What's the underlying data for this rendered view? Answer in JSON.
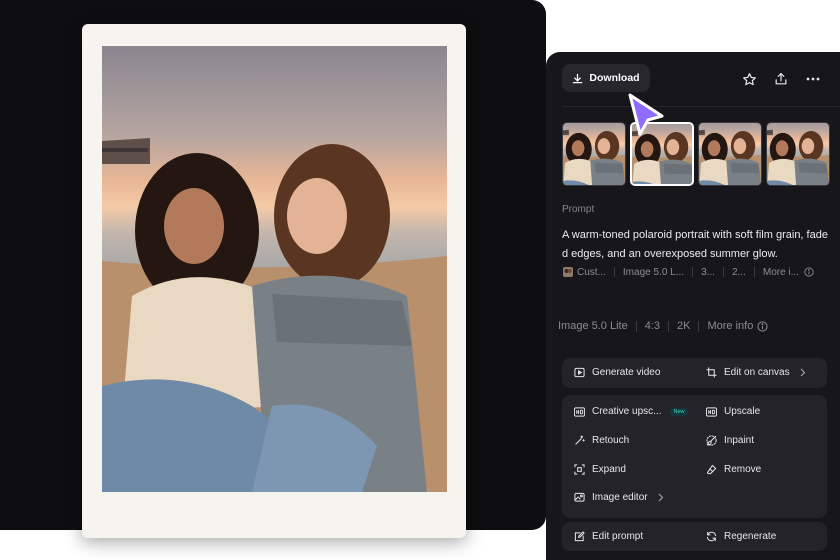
{
  "toolbar": {
    "download_label": "Download",
    "icons": [
      "download-icon",
      "star-icon",
      "share-icon",
      "more-icon"
    ]
  },
  "thumbnails": {
    "count": 4,
    "selected_index": 1
  },
  "prompt": {
    "label": "Prompt",
    "text": "A warm-toned polaroid portrait with soft film grain, faded edges, and an overexposed summer glow."
  },
  "meta_chips": [
    "Cust...",
    "Image 5.0 L...",
    "3...",
    "2...",
    "More i..."
  ],
  "specs": {
    "model": "Image 5.0 Lite",
    "ratio": "4:3",
    "resolution": "2K",
    "more_info": "More info"
  },
  "actions": {
    "generate_video": "Generate video",
    "edit_on_canvas": "Edit on canvas",
    "creative_upscale": "Creative upsc...",
    "new_badge": "New",
    "upscale": "Upscale",
    "retouch": "Retouch",
    "inpaint": "Inpaint",
    "expand": "Expand",
    "remove": "Remove",
    "image_editor": "Image editor",
    "edit_prompt": "Edit prompt",
    "regenerate": "Regenerate"
  },
  "colors": {
    "stage_bg": "#0e0e11",
    "panel_bg": "#17171b",
    "card_bg": "#232329",
    "cursor_accent": "#8f6bff",
    "new_badge": "#48d6c6"
  }
}
